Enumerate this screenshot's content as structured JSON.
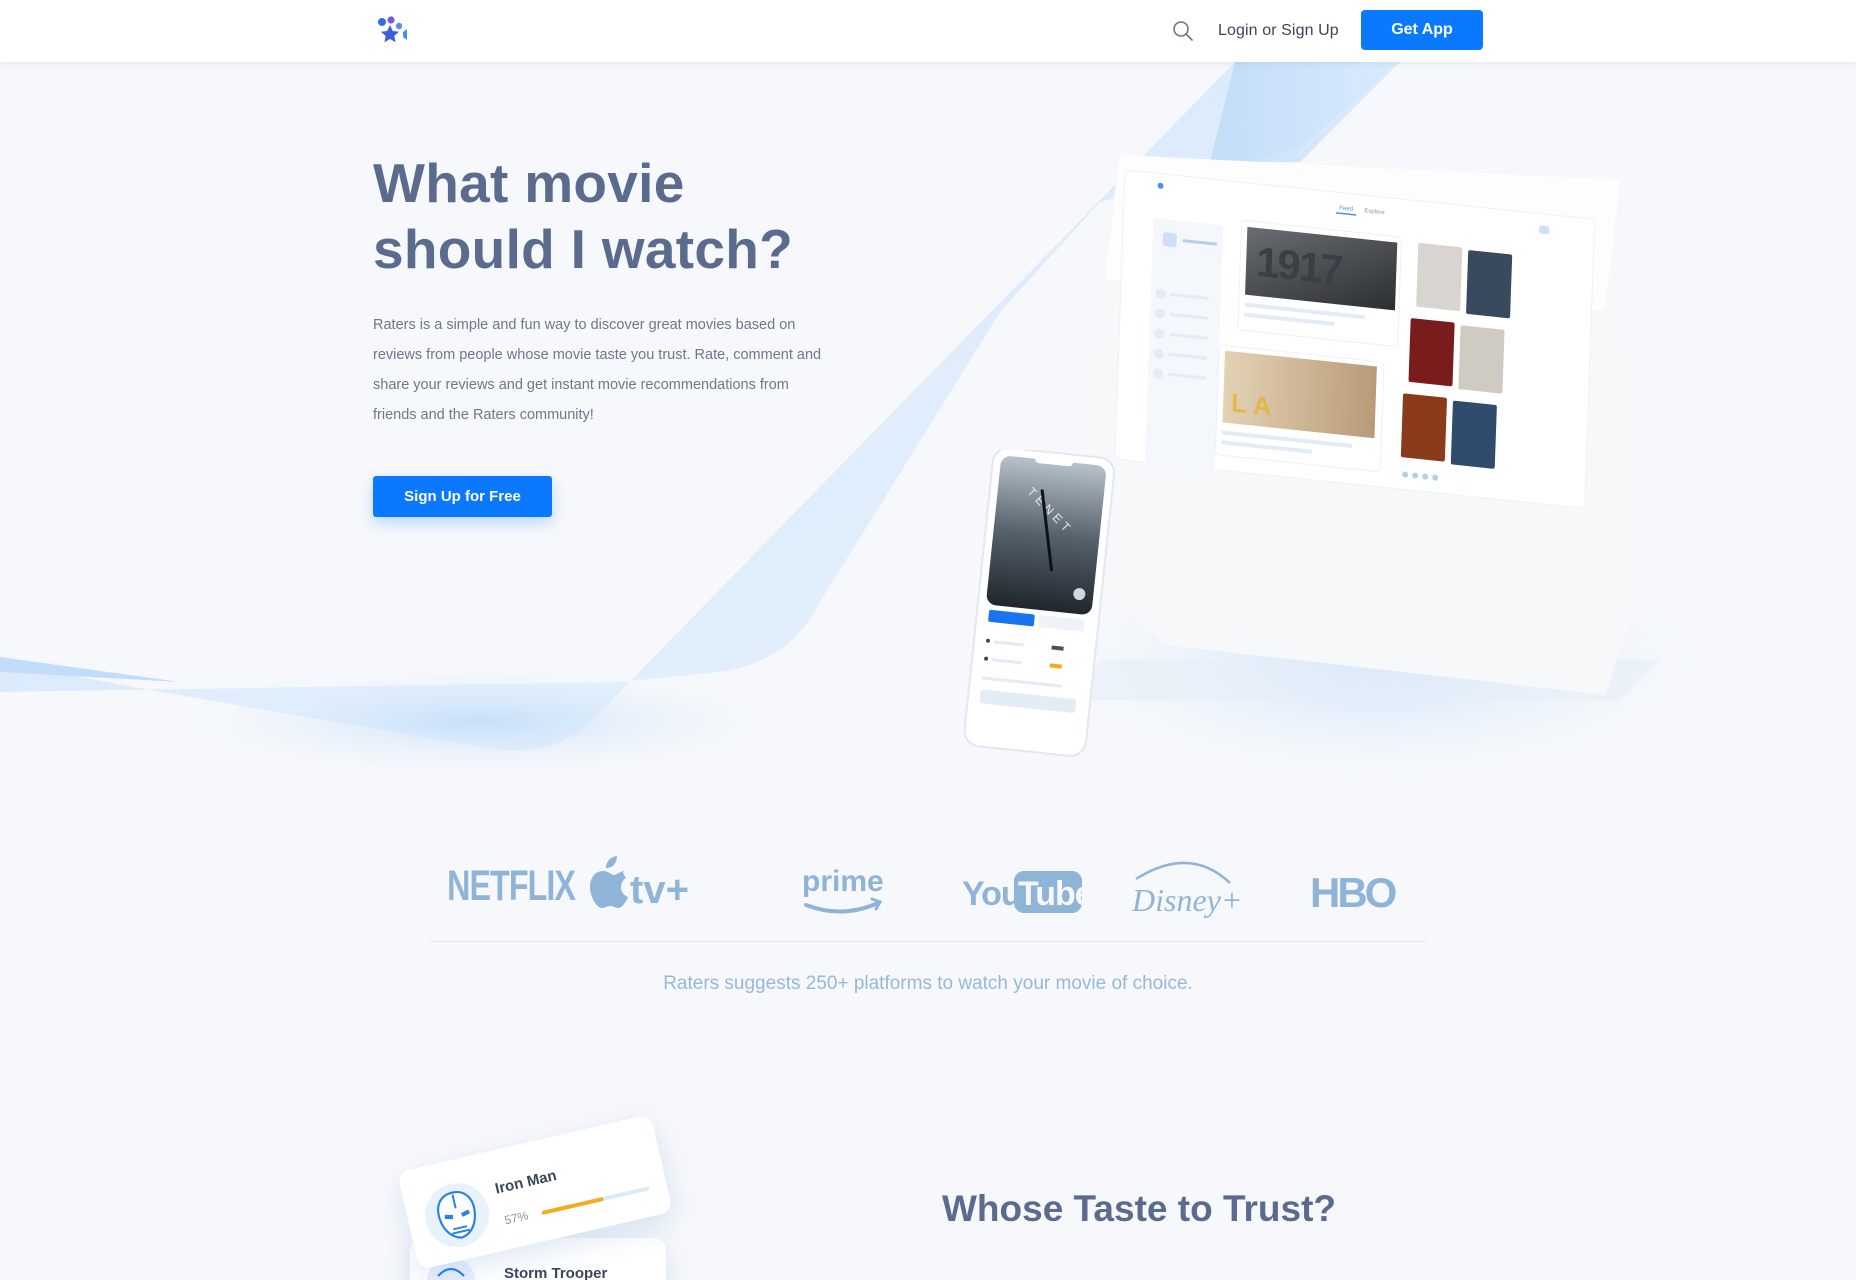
{
  "header": {
    "login_label": "Login or Sign Up",
    "get_app_label": "Get App"
  },
  "hero": {
    "title_line1": "What movie",
    "title_line2": "should I watch?",
    "description": "Raters is a simple and fun way to discover great movies based on reviews from people whose movie taste you trust. Rate, comment and share your reviews and get instant movie recommendations from friends and the Raters community!",
    "cta_label": "Sign Up for Free"
  },
  "laptop_screen": {
    "tab_feed": "Feed",
    "tab_explore": "Explore",
    "featured_poster_text": "1917"
  },
  "phone_screen": {
    "poster_text": "TENET"
  },
  "platforms": {
    "logos": [
      {
        "name": "netflix",
        "text": "NETFLIX"
      },
      {
        "name": "apple-tv-plus",
        "text": "tv+"
      },
      {
        "name": "prime",
        "text": "prime"
      },
      {
        "name": "youtube",
        "text_a": "You",
        "text_b": "Tube"
      },
      {
        "name": "disney-plus",
        "text": "Disney+"
      },
      {
        "name": "hbo",
        "text": "HBO"
      }
    ],
    "caption": "Raters suggests 250+ platforms to watch your movie of choice."
  },
  "trust": {
    "title": "Whose Taste to Trust?",
    "cards": [
      {
        "name": "Iron Man",
        "match": "57%",
        "match_fraction": 0.57
      },
      {
        "name": "Storm Trooper"
      }
    ]
  },
  "colors": {
    "accent": "#0a78ff",
    "heading": "#5b6b8e",
    "logo_blue": "#8fb4d8",
    "rating_bar": "#f2ad1f"
  }
}
